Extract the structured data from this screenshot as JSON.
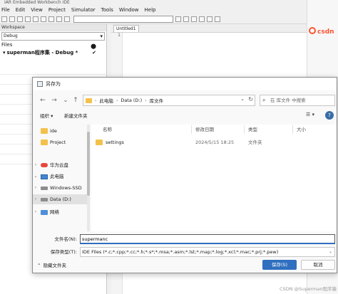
{
  "ide": {
    "title": "IAR Embedded Workbench IDE",
    "menu": [
      "File",
      "Edit",
      "View",
      "Project",
      "Simulator",
      "Tools",
      "Window",
      "Help"
    ],
    "workspace_label": "Workspace",
    "config": "Debug",
    "files_header": "Files",
    "project_name": "superman程序集 - Debug *",
    "editor_tab": "Untitled1",
    "gutter_line": "1"
  },
  "csdn": {
    "logo_text": "csdn"
  },
  "dialog": {
    "title": "另存为",
    "breadcrumb": [
      "此电脑",
      "Data (D:)",
      "库文件"
    ],
    "search_placeholder": "在 库文件 中搜索",
    "organize_label": "组织 ▾",
    "new_folder_label": "新建文件夹",
    "help_label": "?",
    "nav_items": [
      {
        "label": "ide",
        "icon": "folder-icon"
      },
      {
        "label": "Project",
        "icon": "folder-icon"
      },
      {
        "label": "华为云盘",
        "icon": "cloud-icon"
      },
      {
        "label": "此电脑",
        "icon": "computer-icon"
      },
      {
        "label": "Windows-SSD",
        "icon": "drive-icon"
      },
      {
        "label": "Data (D:)",
        "icon": "drive-icon"
      },
      {
        "label": "网络",
        "icon": "network-icon"
      }
    ],
    "columns": {
      "name": "名称",
      "modified": "修改日期",
      "type": "类型",
      "size": "大小"
    },
    "files": [
      {
        "name": "settings",
        "modified": "2024/5/15 18:25",
        "type": "文件夹"
      }
    ],
    "file_name_label": "文件名(N):",
    "file_name_value": "supermanc",
    "save_type_label": "保存类型(T):",
    "save_type_value": "IDE Files (*.c;*.cpp;*.cc;*.h;*.s*;*.msa;*.asm;*.lst;*.map;*.log;*.xcl;*.mac;*.prj;*.pew)",
    "hide_folders_label": "隐藏文件夹",
    "save_label": "保存(S)",
    "cancel_label": "取消"
  },
  "watermark": "CSDN @Superman程序猿"
}
